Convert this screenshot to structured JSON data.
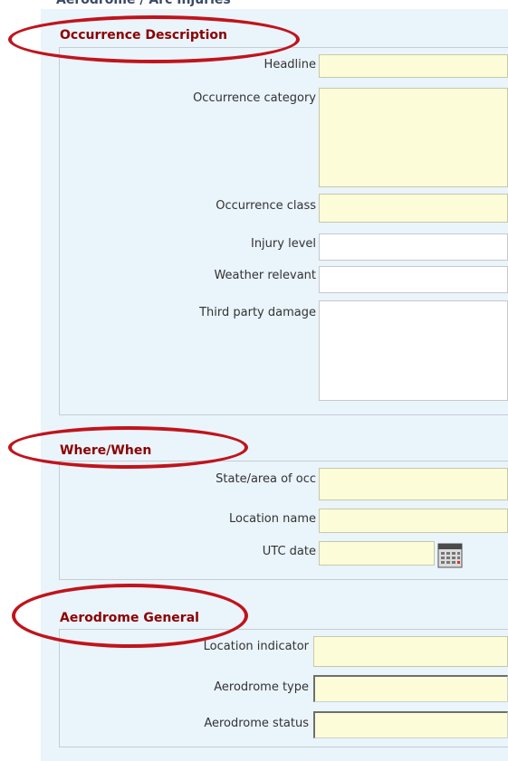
{
  "top_clipped_text": "Aerodrome / Arc Injuries",
  "sections": {
    "occurrence": {
      "title": "Occurrence Description",
      "labels": {
        "headline": "Headline",
        "category": "Occurrence category",
        "class": "Occurrence class",
        "injury": "Injury level",
        "weather": "Weather relevant",
        "third_party": "Third party damage"
      }
    },
    "where_when": {
      "title": "Where/When",
      "labels": {
        "state": "State/area of occ",
        "location": "Location name",
        "utc": "UTC date"
      }
    },
    "aerodrome": {
      "title": "Aerodrome General",
      "labels": {
        "indicator": "Location indicator",
        "type": "Aerodrome type",
        "status": "Aerodrome status"
      }
    }
  },
  "colors": {
    "section_title": "#8b0000",
    "highlight_ellipse": "#c0141c",
    "field_yellow": "#fdfcd9",
    "panel_bg": "#eaf4fb"
  },
  "icons": {
    "calendar": "calendar-icon"
  }
}
